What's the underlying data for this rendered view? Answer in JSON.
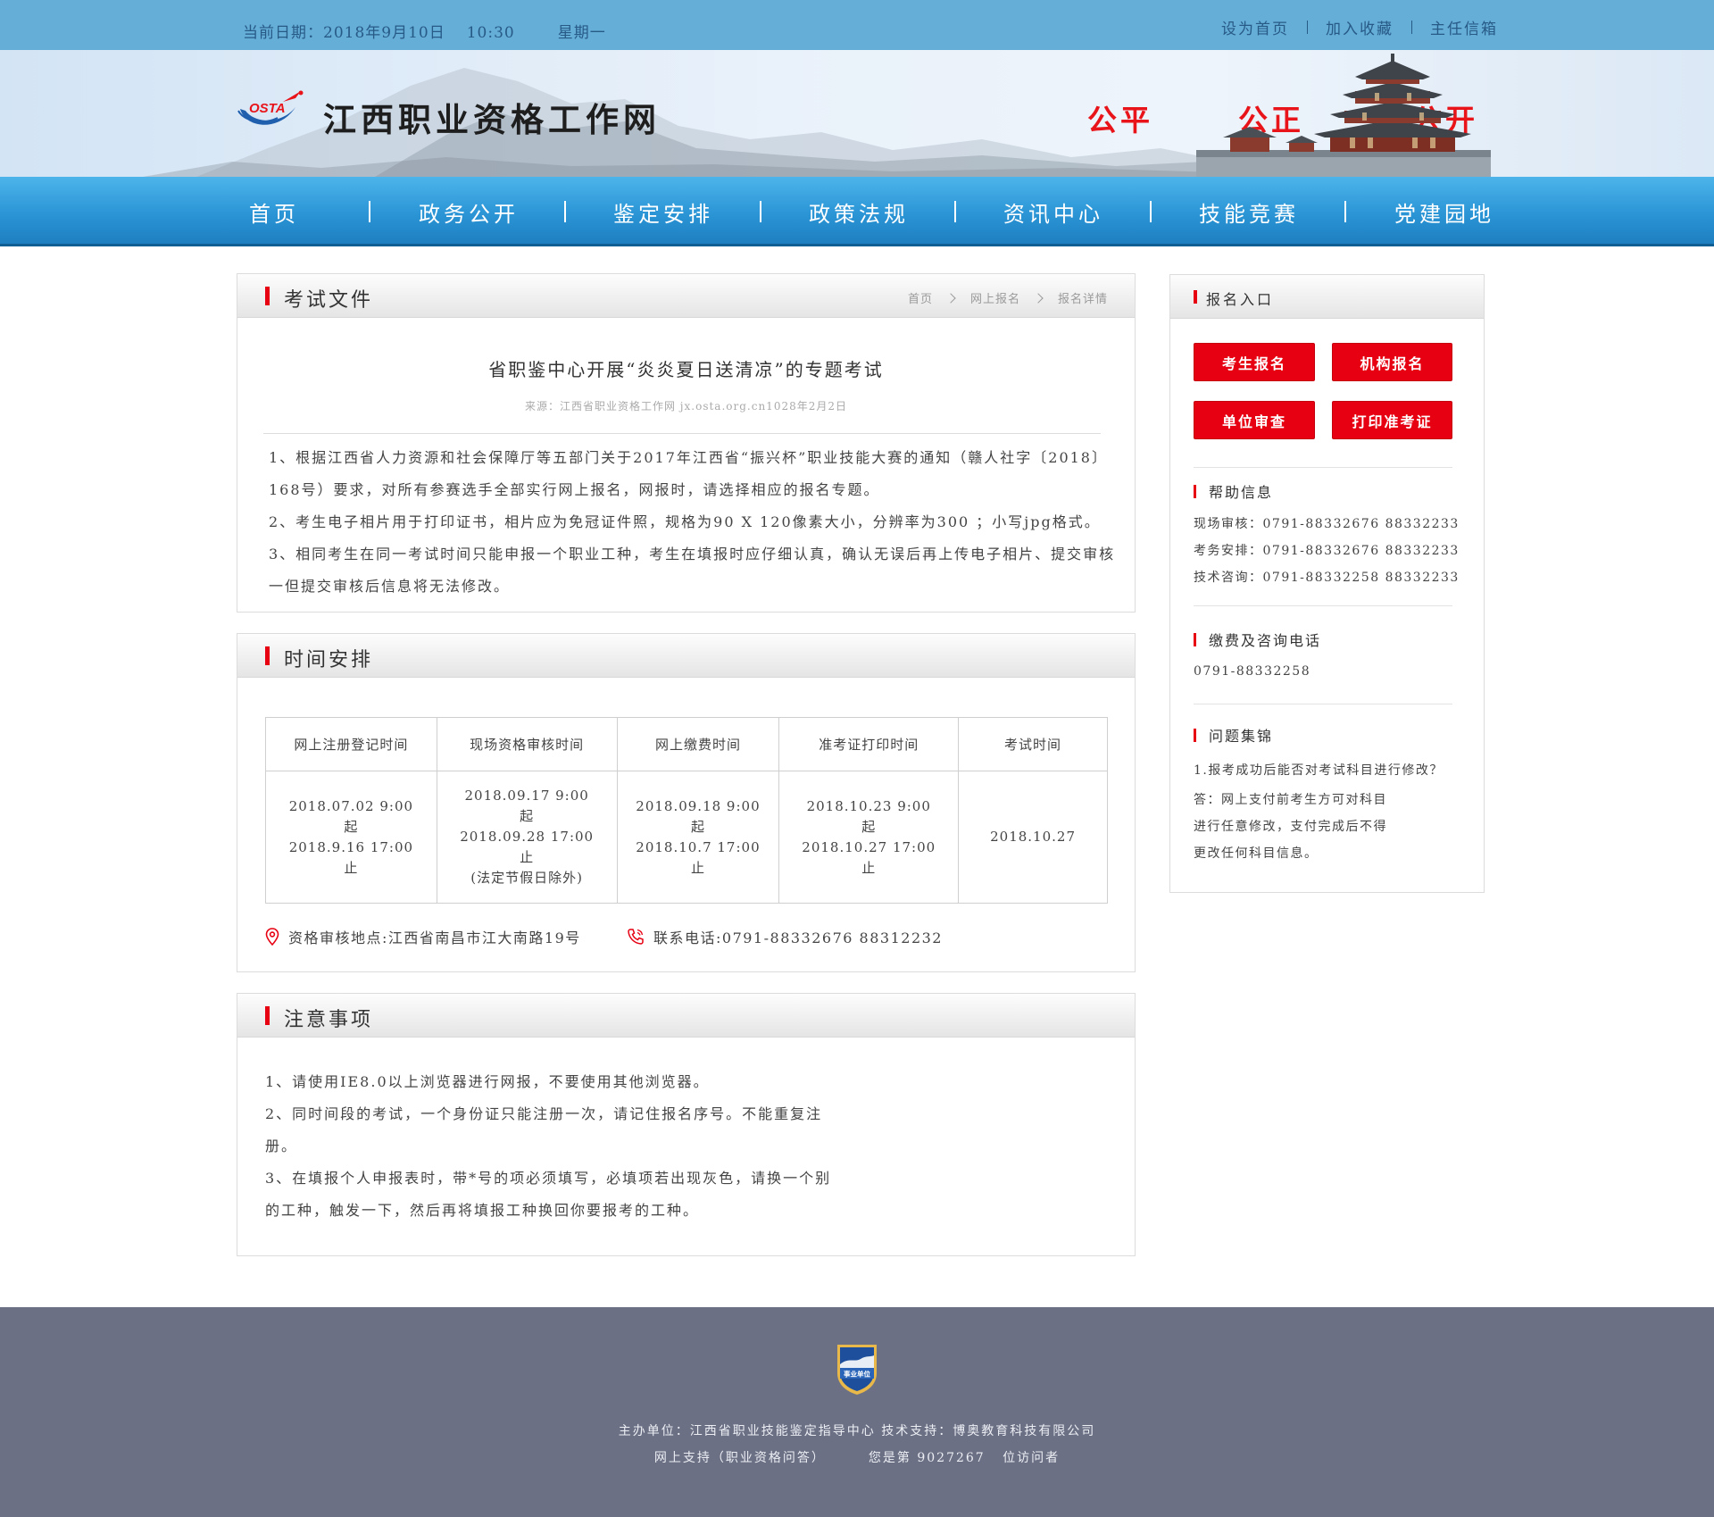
{
  "colors": {
    "accent_red": "#e60012",
    "topbar_bg": "#64aed8",
    "nav_bg": "#2b95d6",
    "footer_bg": "#6b7084"
  },
  "topbar": {
    "date_label": "当前日期：",
    "date": "2018年9月10日",
    "time": "10:30",
    "weekday": "星期一",
    "links": [
      "设为首页",
      "加入收藏",
      "主任信箱"
    ]
  },
  "header": {
    "logo_text": "OSTA",
    "site_title": "江西职业资格工作网",
    "slogans": [
      "公平",
      "公正",
      "公开"
    ]
  },
  "nav": [
    "首页",
    "政务公开",
    "鉴定安排",
    "政策法规",
    "资讯中心",
    "技能竞赛",
    "党建园地"
  ],
  "exam_doc": {
    "section_title": "考试文件",
    "breadcrumb": [
      "首页",
      "网上报名",
      "报名详情"
    ],
    "title": "省职鉴中心开展“炎炎夏日送清凉”的专题考试",
    "source": "来源：江西省职业资格工作网 jx.osta.org.cn1028年2月2日",
    "paragraphs": [
      "1、根据江西省人力资源和社会保障厅等五部门关于2017年江西省“振兴杯”职业技能大赛的通知（赣人社字〔2018〕168号）要求，对所有参赛选手全部实行网上报名，网报时，请选择相应的报名专题。",
      "2、考生电子相片用于打印证书，相片应为免冠证件照，规格为90 X 120像素大小，分辨率为300 ；小写jpg格式。",
      "3、相同考生在同一考试时间只能申报一个职业工种，考生在填报时应仔细认真，确认无误后再上传电子相片、提交审核一但提交审核后信息将无法修改。"
    ]
  },
  "schedule": {
    "section_title": "时间安排",
    "headers": [
      "网上注册登记时间",
      "现场资格审核时间",
      "网上缴费时间",
      "准考证打印时间",
      "考试时间"
    ],
    "cells": [
      [
        "2018.07.02 9:00",
        "起",
        "2018.9.16 17:00",
        "止"
      ],
      [
        "2018.09.17 9:00",
        "起",
        "2018.09.28 17:00",
        "止",
        "(法定节假日除外)"
      ],
      [
        "2018.09.18 9:00",
        "起",
        "2018.10.7 17:00",
        "止"
      ],
      [
        "2018.10.23 9:00",
        "起",
        "2018.10.27 17:00",
        "止"
      ],
      [
        "2018.10.27"
      ]
    ],
    "address": "资格审核地点:江西省南昌市江大南路19号",
    "phone": "联系电话:0791-88332676 88312232"
  },
  "notice": {
    "section_title": "注意事项",
    "items": [
      "1、请使用IE8.0以上浏览器进行网报，不要使用其他浏览器。",
      "2、同时间段的考试，一个身份证只能注册一次，请记住报名序号。不能重复注册。",
      "3、在填报个人申报表时，带*号的项必须填写，必填项若出现灰色，请换一个别的工种，触发一下，然后再将填报工种换回你要报考的工种。"
    ]
  },
  "sidebar": {
    "entry_title": "报名入口",
    "buttons": [
      "考生报名",
      "机构报名",
      "单位审查",
      "打印准考证"
    ],
    "help": {
      "title": "帮助信息",
      "items": [
        {
          "label": "现场审核：",
          "value": "0791-88332676 88332233"
        },
        {
          "label": "考务安排：",
          "value": "0791-88332676 88332233"
        },
        {
          "label": "技术咨询：",
          "value": "0791-88332258 88332233"
        }
      ]
    },
    "payment": {
      "title": "缴费及咨询电话",
      "phone": "0791-88332258"
    },
    "faq": {
      "title": "问题集锦",
      "question": "1.报考成功后能否对考试科目进行修改？",
      "answer": "答：网上支付前考生方可对科目进行任意修改，支付完成后不得更改任何科目信息。"
    }
  },
  "footer": {
    "badge_text": "事业单位",
    "sponsor": "主办单位：江西省职业技能鉴定指导中心 技术支持：博奥教育科技有限公司",
    "support": "网上支持（职业资格问答）",
    "visitor_prefix": "您是第",
    "visitor_count": "9027267",
    "visitor_suffix": "位访问者"
  },
  "icons": {
    "address": "location-pin-icon",
    "phone": "phone-icon",
    "breadcrumb_separator": "chevron-right-icon"
  }
}
